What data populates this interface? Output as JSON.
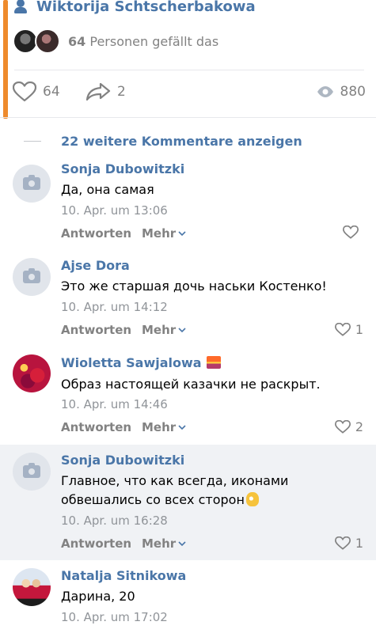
{
  "post": {
    "author_name": "Wiktorija Schtscherbakowa",
    "likes_count_bold": "64",
    "likes_text": "Personen gefällt das",
    "like_count": "64",
    "share_count": "2",
    "view_count": "880"
  },
  "more_comments_label": "22 weitere Kommentare anzeigen",
  "labels": {
    "reply": "Antworten",
    "more": "Mehr"
  },
  "comments": [
    {
      "name": "Sonja Dubowitzki",
      "text": "Да, она самая",
      "date": "10. Apr. um 13:06",
      "likes": ""
    },
    {
      "name": "Ajse Dora",
      "text": "Это же старшая дочь наськи Костенко!",
      "date": "10. Apr. um 14:12",
      "likes": "1"
    },
    {
      "name": "Wioletta Sawjalowa",
      "text": "Образ настоящей казачки не раскрыт.",
      "date": "10. Apr. um 14:46",
      "likes": "2"
    },
    {
      "name": "Sonja Dubowitzki",
      "text_line1": "Главное, что как всегда, иконами",
      "text_line2": "обвешались со всех сторон",
      "date": "10. Apr. um 16:28",
      "likes": "1"
    },
    {
      "name": "Natalja Sitnikowa",
      "text": "Дарина, 20",
      "date": "10. Apr. um 17:02",
      "likes": ""
    }
  ],
  "colors": {
    "accent": "#4a76a8",
    "highlight": "#f0f2f5",
    "orange_marker": "#ee8a2c"
  }
}
